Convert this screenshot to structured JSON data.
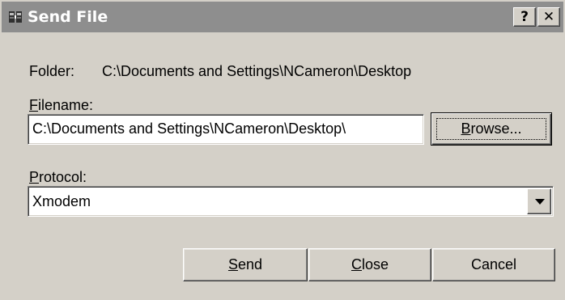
{
  "window": {
    "title": "Send File",
    "help_glyph": "?",
    "close_glyph": "✕",
    "icon": "app-icon"
  },
  "folder": {
    "label": "Folder:",
    "value": "C:\\Documents and Settings\\NCameron\\Desktop"
  },
  "filename": {
    "label_mnemonic": "F",
    "label_rest": "ilename:",
    "value": "C:\\Documents and Settings\\NCameron\\Desktop\\"
  },
  "browse": {
    "mnemonic": "B",
    "rest": "rowse..."
  },
  "protocol": {
    "label_mnemonic": "P",
    "label_rest": "rotocol:",
    "selected": "Xmodem"
  },
  "buttons": {
    "send": {
      "mnemonic": "S",
      "rest": "end"
    },
    "close": {
      "mnemonic": "C",
      "rest": "lose"
    },
    "cancel": {
      "label": "Cancel"
    }
  },
  "colors": {
    "dialog_bg": "#d4d0c8",
    "titlebar_bg": "#8e8e8e",
    "titlebar_text": "#ffffff"
  }
}
